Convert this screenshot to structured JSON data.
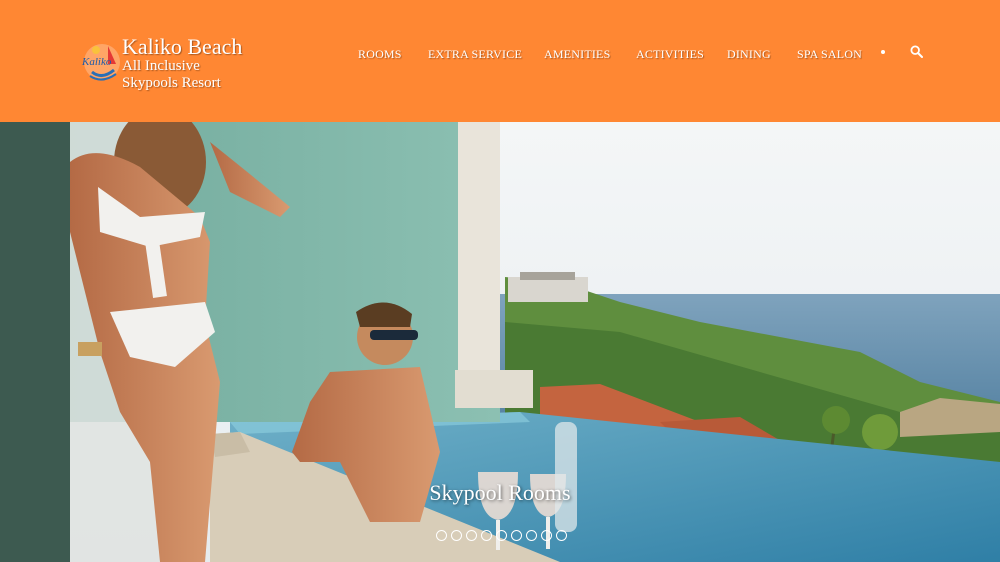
{
  "brand": {
    "name": "Kaliko Beach",
    "tagline_1": "All Inclusive",
    "tagline_2": "Skypools Resort",
    "logo_text": "Kaliko"
  },
  "nav": {
    "items": [
      "ROOMS",
      "EXTRA SERVICE",
      "AMENITIES",
      "ACTIVITIES",
      "DINING",
      "SPA SALON"
    ],
    "search_icon": "search-icon"
  },
  "hero": {
    "caption": "Skypool Rooms",
    "slide_count": 9,
    "active_slide": 0
  },
  "colors": {
    "header_bg": "#ff8733",
    "text": "#ffffff"
  }
}
